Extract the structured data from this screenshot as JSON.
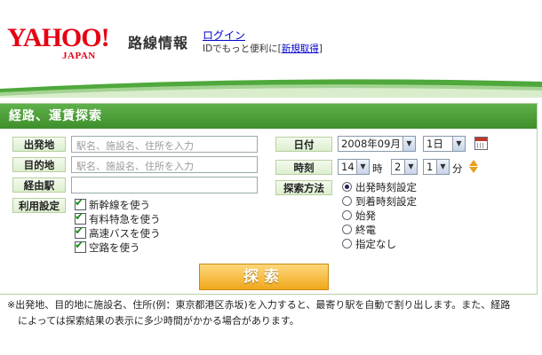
{
  "header": {
    "logo_word": "YAHOO!",
    "logo_sub": "JAPAN",
    "service_title": "路線情報",
    "login_label": "ログイン",
    "id_text": "IDでもっと便利に[",
    "register_label": "新規取得",
    "id_text_end": "]"
  },
  "section": {
    "title": "経路、運賃探索"
  },
  "form": {
    "departure": {
      "label": "出発地",
      "placeholder": "駅名、施設名、住所を入力"
    },
    "destination": {
      "label": "目的地",
      "placeholder": "駅名、施設名、住所を入力"
    },
    "via": {
      "label": "経由駅",
      "value": ""
    },
    "options": {
      "label": "利用設定",
      "items": [
        {
          "label": "新幹線を使う",
          "checked": true
        },
        {
          "label": "有料特急を使う",
          "checked": true
        },
        {
          "label": "高速バスを使う",
          "checked": true
        },
        {
          "label": "空路を使う",
          "checked": true
        }
      ]
    },
    "date": {
      "label": "日付",
      "month_value": "2008年09月",
      "day_value": "1日"
    },
    "time": {
      "label": "時刻",
      "hour_value": "14",
      "hour_unit": "時",
      "min10_value": "2",
      "min1_value": "1",
      "min_unit": "分"
    },
    "search_method": {
      "label": "探索方法",
      "options": [
        {
          "label": "出発時刻設定",
          "selected": true
        },
        {
          "label": "到着時刻設定",
          "selected": false
        },
        {
          "label": "始発",
          "selected": false
        },
        {
          "label": "終電",
          "selected": false
        },
        {
          "label": "指定なし",
          "selected": false
        }
      ]
    },
    "search_button": "探索"
  },
  "note": {
    "line1": "※出発地、目的地に施設名、住所(例：東京都港区赤坂)を入力すると、最寄り駅を自動で割り出します。また、経路",
    "line2": "によっては探索結果の表示に多少時間がかかる場合があります。"
  },
  "colors": {
    "brand": "#e60012",
    "accent_green": "#3e8f2c",
    "button": "#f0a81c"
  },
  "icons": [
    "calendar-icon",
    "spinner-arrows-icon"
  ]
}
